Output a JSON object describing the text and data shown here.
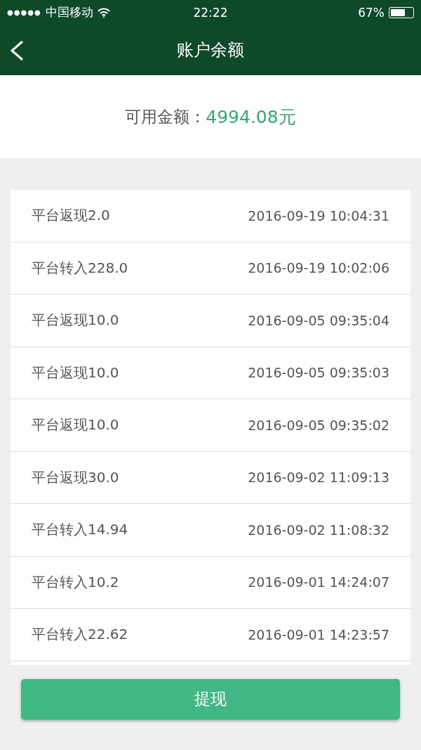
{
  "status_bar": {
    "signal_dots": "●●●●●",
    "carrier": "中国移动",
    "time": "22:22",
    "battery_text": "67%"
  },
  "nav_bar": {
    "title": "账户余额"
  },
  "balance": {
    "label": "可用金额：",
    "amount": "4994.08元"
  },
  "records": [
    {
      "description": "平台返现2.0",
      "time": "2016-09-19 10:04:31"
    },
    {
      "description": "平台转入228.0",
      "time": "2016-09-19 10:02:06"
    },
    {
      "description": "平台返现10.0",
      "time": "2016-09-05 09:35:04"
    },
    {
      "description": "平台返现10.0",
      "time": "2016-09-05 09:35:03"
    },
    {
      "description": "平台返现10.0",
      "time": "2016-09-05 09:35:02"
    },
    {
      "description": "平台返现30.0",
      "time": "2016-09-02 11:09:13"
    },
    {
      "description": "平台转入14.94",
      "time": "2016-09-02 11:08:32"
    },
    {
      "description": "平台转入10.2",
      "time": "2016-09-01 14:24:07"
    },
    {
      "description": "平台转入22.62",
      "time": "2016-09-01 14:23:57"
    }
  ],
  "withdraw_button": {
    "label": "提现"
  }
}
